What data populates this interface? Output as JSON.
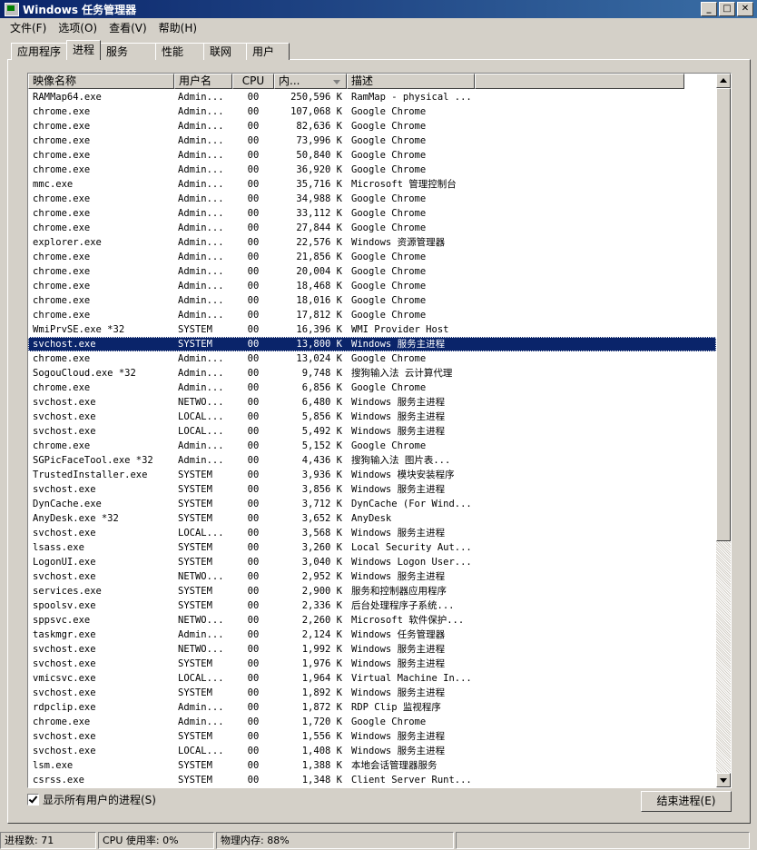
{
  "window": {
    "title": "Windows 任务管理器",
    "min": "_",
    "max": "□",
    "close": "✕"
  },
  "menu": [
    "文件(F)",
    "选项(O)",
    "查看(V)",
    "帮助(H)"
  ],
  "tabs": [
    "应用程序",
    "进程",
    "服务",
    "性能",
    "联网",
    "用户"
  ],
  "columns": [
    "映像名称",
    "用户名",
    "CPU",
    "内...",
    "描述"
  ],
  "rows": [
    [
      "RAMMap64.exe",
      "Admin...",
      "00",
      "250,596 K",
      "RamMap - physical ..."
    ],
    [
      "chrome.exe",
      "Admin...",
      "00",
      "107,068 K",
      "Google Chrome"
    ],
    [
      "chrome.exe",
      "Admin...",
      "00",
      "82,636 K",
      "Google Chrome"
    ],
    [
      "chrome.exe",
      "Admin...",
      "00",
      "73,996 K",
      "Google Chrome"
    ],
    [
      "chrome.exe",
      "Admin...",
      "00",
      "50,840 K",
      "Google Chrome"
    ],
    [
      "chrome.exe",
      "Admin...",
      "00",
      "36,920 K",
      "Google Chrome"
    ],
    [
      "mmc.exe",
      "Admin...",
      "00",
      "35,716 K",
      "Microsoft 管理控制台"
    ],
    [
      "chrome.exe",
      "Admin...",
      "00",
      "34,988 K",
      "Google Chrome"
    ],
    [
      "chrome.exe",
      "Admin...",
      "00",
      "33,112 K",
      "Google Chrome"
    ],
    [
      "chrome.exe",
      "Admin...",
      "00",
      "27,844 K",
      "Google Chrome"
    ],
    [
      "explorer.exe",
      "Admin...",
      "00",
      "22,576 K",
      "Windows 资源管理器"
    ],
    [
      "chrome.exe",
      "Admin...",
      "00",
      "21,856 K",
      "Google Chrome"
    ],
    [
      "chrome.exe",
      "Admin...",
      "00",
      "20,004 K",
      "Google Chrome"
    ],
    [
      "chrome.exe",
      "Admin...",
      "00",
      "18,468 K",
      "Google Chrome"
    ],
    [
      "chrome.exe",
      "Admin...",
      "00",
      "18,016 K",
      "Google Chrome"
    ],
    [
      "chrome.exe",
      "Admin...",
      "00",
      "17,812 K",
      "Google Chrome"
    ],
    [
      "WmiPrvSE.exe *32",
      "SYSTEM",
      "00",
      "16,396 K",
      "WMI Provider Host"
    ],
    [
      "svchost.exe",
      "SYSTEM",
      "00",
      "13,800 K",
      "Windows 服务主进程"
    ],
    [
      "chrome.exe",
      "Admin...",
      "00",
      "13,024 K",
      "Google Chrome"
    ],
    [
      "SogouCloud.exe *32",
      "Admin...",
      "00",
      "9,748 K",
      "搜狗输入法 云计算代理"
    ],
    [
      "chrome.exe",
      "Admin...",
      "00",
      "6,856 K",
      "Google Chrome"
    ],
    [
      "svchost.exe",
      "NETWO...",
      "00",
      "6,480 K",
      "Windows 服务主进程"
    ],
    [
      "svchost.exe",
      "LOCAL...",
      "00",
      "5,856 K",
      "Windows 服务主进程"
    ],
    [
      "svchost.exe",
      "LOCAL...",
      "00",
      "5,492 K",
      "Windows 服务主进程"
    ],
    [
      "chrome.exe",
      "Admin...",
      "00",
      "5,152 K",
      "Google Chrome"
    ],
    [
      "SGPicFaceTool.exe *32",
      "Admin...",
      "00",
      "4,436 K",
      "搜狗输入法 图片表..."
    ],
    [
      "TrustedInstaller.exe",
      "SYSTEM",
      "00",
      "3,936 K",
      "Windows 模块安装程序"
    ],
    [
      "svchost.exe",
      "SYSTEM",
      "00",
      "3,856 K",
      "Windows 服务主进程"
    ],
    [
      "DynCache.exe",
      "SYSTEM",
      "00",
      "3,712 K",
      "DynCache (For Wind..."
    ],
    [
      "AnyDesk.exe *32",
      "SYSTEM",
      "00",
      "3,652 K",
      "AnyDesk"
    ],
    [
      "svchost.exe",
      "LOCAL...",
      "00",
      "3,568 K",
      "Windows 服务主进程"
    ],
    [
      "lsass.exe",
      "SYSTEM",
      "00",
      "3,260 K",
      "Local Security Aut..."
    ],
    [
      "LogonUI.exe",
      "SYSTEM",
      "00",
      "3,040 K",
      "Windows Logon User..."
    ],
    [
      "svchost.exe",
      "NETWO...",
      "00",
      "2,952 K",
      "Windows 服务主进程"
    ],
    [
      "services.exe",
      "SYSTEM",
      "00",
      "2,900 K",
      "服务和控制器应用程序"
    ],
    [
      "spoolsv.exe",
      "SYSTEM",
      "00",
      "2,336 K",
      "后台处理程序子系统..."
    ],
    [
      "sppsvc.exe",
      "NETWO...",
      "00",
      "2,260 K",
      "Microsoft 软件保护..."
    ],
    [
      "taskmgr.exe",
      "Admin...",
      "00",
      "2,124 K",
      "Windows 任务管理器"
    ],
    [
      "svchost.exe",
      "NETWO...",
      "00",
      "1,992 K",
      "Windows 服务主进程"
    ],
    [
      "svchost.exe",
      "SYSTEM",
      "00",
      "1,976 K",
      "Windows 服务主进程"
    ],
    [
      "vmicsvc.exe",
      "LOCAL...",
      "00",
      "1,964 K",
      "Virtual Machine In..."
    ],
    [
      "svchost.exe",
      "SYSTEM",
      "00",
      "1,892 K",
      "Windows 服务主进程"
    ],
    [
      "rdpclip.exe",
      "Admin...",
      "00",
      "1,872 K",
      "RDP Clip 监视程序"
    ],
    [
      "chrome.exe",
      "Admin...",
      "00",
      "1,720 K",
      "Google Chrome"
    ],
    [
      "svchost.exe",
      "SYSTEM",
      "00",
      "1,556 K",
      "Windows 服务主进程"
    ],
    [
      "svchost.exe",
      "LOCAL...",
      "00",
      "1,408 K",
      "Windows 服务主进程"
    ],
    [
      "lsm.exe",
      "SYSTEM",
      "00",
      "1,388 K",
      "本地会话管理器服务"
    ],
    [
      "csrss.exe",
      "SYSTEM",
      "00",
      "1,348 K",
      "Client Server Runt..."
    ]
  ],
  "selected_row": 17,
  "show_all_users": "显示所有用户的进程(S)",
  "end_process": "结束进程(E)",
  "status": {
    "process_count": "进程数: 71",
    "cpu": "CPU 使用率: 0%",
    "memory": "物理内存: 88%"
  }
}
